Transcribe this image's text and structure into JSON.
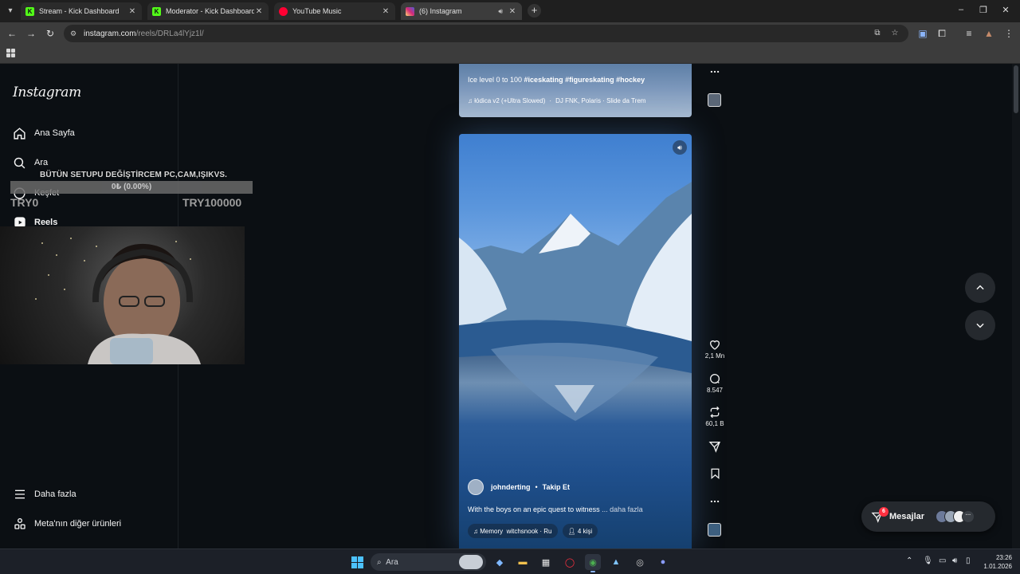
{
  "browser": {
    "tabs": [
      {
        "title": "Stream - Kick Dashboard",
        "fav": "K",
        "fav_color": "#53fc18",
        "active": false
      },
      {
        "title": "Moderator - Kick Dashboard",
        "fav": "K",
        "fav_color": "#53fc18",
        "active": false
      },
      {
        "title": "YouTube Music",
        "fav": "",
        "fav_color": "#ff0033",
        "active": false
      },
      {
        "title": "(6) Instagram",
        "fav": "",
        "fav_color": "#d62976",
        "active": true
      }
    ],
    "url_host": "instagram.com",
    "url_path": "/reels/DRLa4lYjz1l/"
  },
  "sidebar": {
    "logo": "Instagram",
    "items": [
      {
        "label": "Ana Sayfa",
        "icon": "home-icon"
      },
      {
        "label": "Ara",
        "icon": "search-icon"
      },
      {
        "label": "Keşfet",
        "icon": "explore-icon"
      },
      {
        "label": "Reels",
        "icon": "reels-icon"
      },
      {
        "label": "Daha fazla",
        "icon": "menu-icon"
      },
      {
        "label": "Meta'nın diğer ürünleri",
        "icon": "meta-products-icon"
      }
    ]
  },
  "stream_overlay": {
    "goal_title": "BÜTÜN SETUPU DEĞİŞTİRCEM PC,CAM,IŞIKVS.",
    "goal_progress_label": "0₺ (0.00%)",
    "goal_progress_fraction": 0.0,
    "goal_min": "TRY0",
    "goal_max": "TRY100000",
    "goal_fill_color": "#2fa54a"
  },
  "reel_prev": {
    "caption_plain": "Ice level 0 to 100 ",
    "caption_tags": "#iceskating #figureskating #hockey",
    "audio_track": "łódica v2 (+Ultra Slowed)",
    "audio_artists": "DJ FNK, Polaris · Slide da Trem"
  },
  "reel_main": {
    "username": "johnderting",
    "dot": "•",
    "follow_label": "Takip Et",
    "caption": "With the boys on an epic quest to witness",
    "more_label": "... daha fazla",
    "audio_title": "Memory",
    "audio_artist": "witchsnook · Ru",
    "people_label": "4 kişi"
  },
  "actions": {
    "likes": "2,1 Mn",
    "comments": "8.547",
    "reposts": "60,1 B"
  },
  "messages": {
    "label": "Mesajlar",
    "badge": "6"
  },
  "taskbar": {
    "search_label": "Ara",
    "time": "23:26",
    "date": "1.01.2026"
  }
}
